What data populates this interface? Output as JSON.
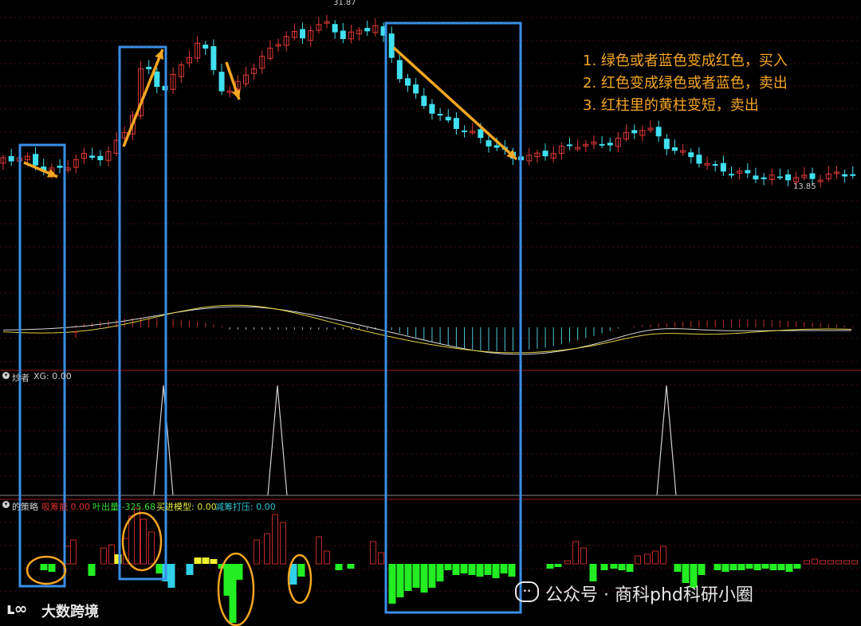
{
  "chart_data": {
    "type": "candlestick",
    "annotations": {
      "max_label": "31.87",
      "min_label": "13.85",
      "notes": [
        "1. 绿色或者蓝色变成红色，买入",
        "2. 红色变成绿色或者蓝色，卖出",
        "3. 红柱里的黄柱变短，卖出"
      ]
    },
    "indicator_xg": {
      "title": "炒者",
      "label": "XG: 0.00"
    },
    "strategy_panel": {
      "title": "的策略",
      "items": [
        {
          "label": "吸筹能 0.00",
          "color": "#e03030"
        },
        {
          "label": "叶出量 -325.68",
          "color": "#33dd33"
        },
        {
          "label": "买进模型: 0.00",
          "color": "#e6e63a"
        },
        {
          "label": "减筹打压: 0.00",
          "color": "#30c8d8"
        }
      ]
    },
    "colors": {
      "up": "#e03838",
      "down": "#40e0f0",
      "hist_green": "#22ee22",
      "hist_yellow": "#f0f030",
      "hist_cyan": "#30d0e8",
      "annotation": "#f5a623",
      "highlight_box": "#3a8ee8"
    }
  },
  "watermark": {
    "left_brand": "大数跨境",
    "right_text": "公众号 · 商科phd科研小圈"
  }
}
